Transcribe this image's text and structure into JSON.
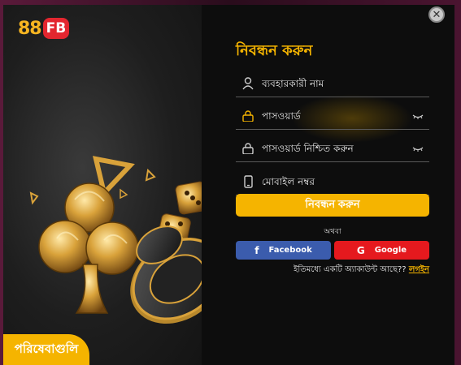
{
  "brand": {
    "logo_num": "88",
    "logo_letters": "FB"
  },
  "left_panel": {
    "services_label": "পরিষেবাগুলি"
  },
  "modal": {
    "title": "নিবন্ধন করুন",
    "fields": {
      "username_placeholder": "ব্যবহারকারী নাম",
      "password_placeholder": "পাসওয়ার্ড",
      "confirm_password_placeholder": "পাসওয়ার্ড নিশ্চিত করুন",
      "mobile_placeholder": "মোবাইল নম্বর"
    },
    "register_button": "নিবন্ধন করুন",
    "or_text": "অথবা",
    "facebook_label": "Facebook",
    "google_label": "Google",
    "have_account_text": "ইতিমধ্যে একটি অ্যাকাউন্ট আছে??",
    "login_link": "লগইন",
    "close_symbol": "✕"
  },
  "colors": {
    "accent": "#f5b400",
    "facebook": "#3b5cad",
    "google": "#e5191e",
    "brand_red": "#e3262f"
  }
}
